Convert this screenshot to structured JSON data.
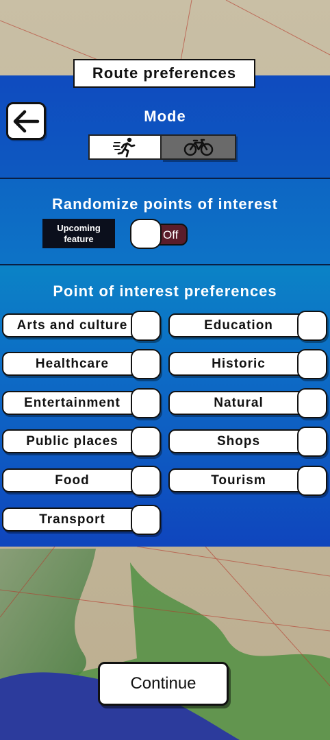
{
  "title": "Route preferences",
  "mode": {
    "label": "Mode",
    "options": [
      {
        "name": "walking-icon",
        "selected": true
      },
      {
        "name": "bicycle-icon",
        "selected": false
      }
    ]
  },
  "randomize": {
    "label": "Randomize points of interest",
    "upcoming_line1": "Upcoming",
    "upcoming_line2": "feature",
    "switch_label": "Off",
    "enabled": false
  },
  "poi": {
    "label": "Point of interest preferences",
    "items": [
      {
        "label": "Arts and culture"
      },
      {
        "label": "Education"
      },
      {
        "label": "Healthcare"
      },
      {
        "label": "Historic"
      },
      {
        "label": "Entertainment"
      },
      {
        "label": "Natural"
      },
      {
        "label": "Public places"
      },
      {
        "label": "Shops"
      },
      {
        "label": "Food"
      },
      {
        "label": "Tourism"
      },
      {
        "label": "Transport"
      }
    ]
  },
  "continue_label": "Continue",
  "colors": {
    "panel_top": "#0f4bbf",
    "panel_mid": "#0d73c6",
    "switch_off": "#5a1d2a"
  }
}
